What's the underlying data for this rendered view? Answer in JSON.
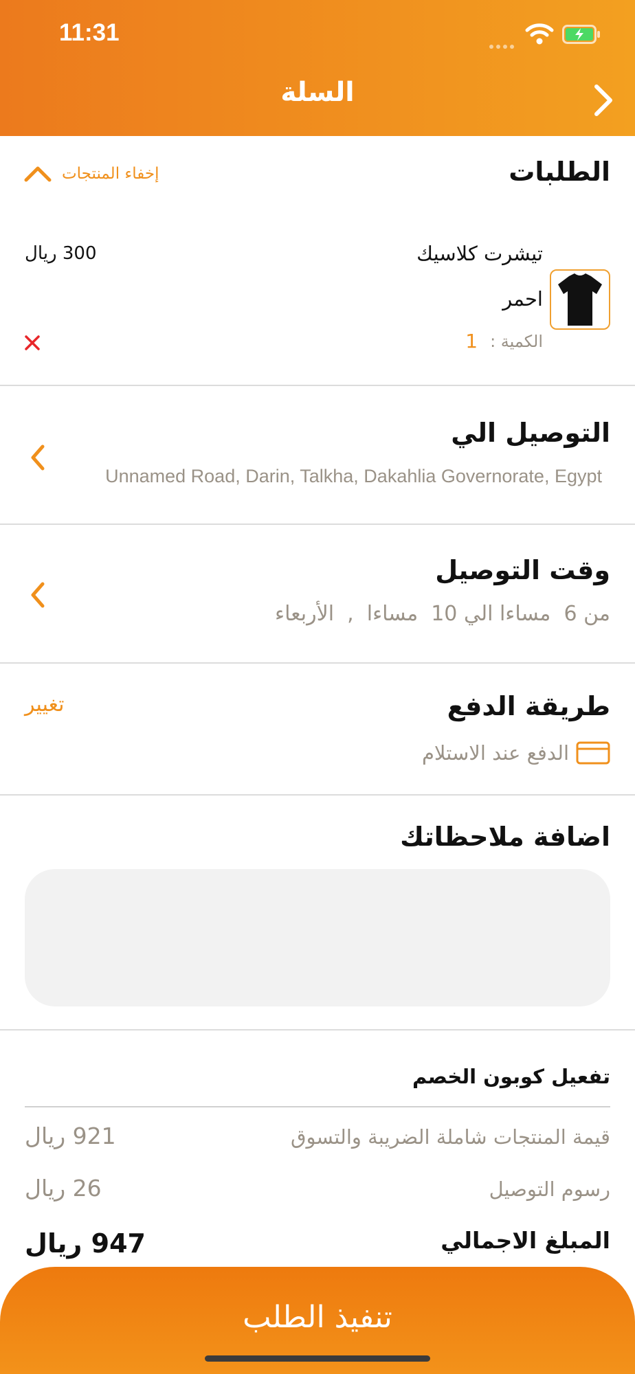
{
  "status_bar": {
    "time": "11:31"
  },
  "header": {
    "title": "السلة"
  },
  "orders": {
    "title": "الطلبات",
    "hide_products": "إخفاء المنتجات",
    "item": {
      "name": "تيشرت كلاسيك",
      "color": "احمر",
      "quantity_label": "الكمية :",
      "quantity": "1",
      "price": "300 ريال"
    }
  },
  "delivery_to": {
    "title": "التوصيل الي",
    "address": "Unnamed Road, Darin, Talkha, Dakahlia Governorate, Egypt"
  },
  "delivery_time": {
    "title": "وقت التوصيل",
    "value": "من 6  مساءا الي 10  مساءا  ,  الأربعاء"
  },
  "payment": {
    "title": "طريقة الدفع",
    "change": "تغيير",
    "method": "الدفع عند الاستلام"
  },
  "notes": {
    "title": "اضافة ملاحظاتك",
    "value": ""
  },
  "coupon": {
    "label": "تفعيل كوبون الخصم"
  },
  "summary": {
    "products_label": "قيمة المنتجات شاملة الضريبة والتسوق",
    "products_value": "921 ريال",
    "delivery_label": "رسوم التوصيل",
    "delivery_value": "26 ريال",
    "total_label": "المبلغ الاجمالي",
    "total_value": "947 ريال"
  },
  "checkout": {
    "label": "تنفيذ الطلب"
  },
  "colors": {
    "accent": "#f0901c",
    "header_start": "#ec7a1d",
    "header_end": "#f3a020",
    "remove": "#e8262a"
  }
}
